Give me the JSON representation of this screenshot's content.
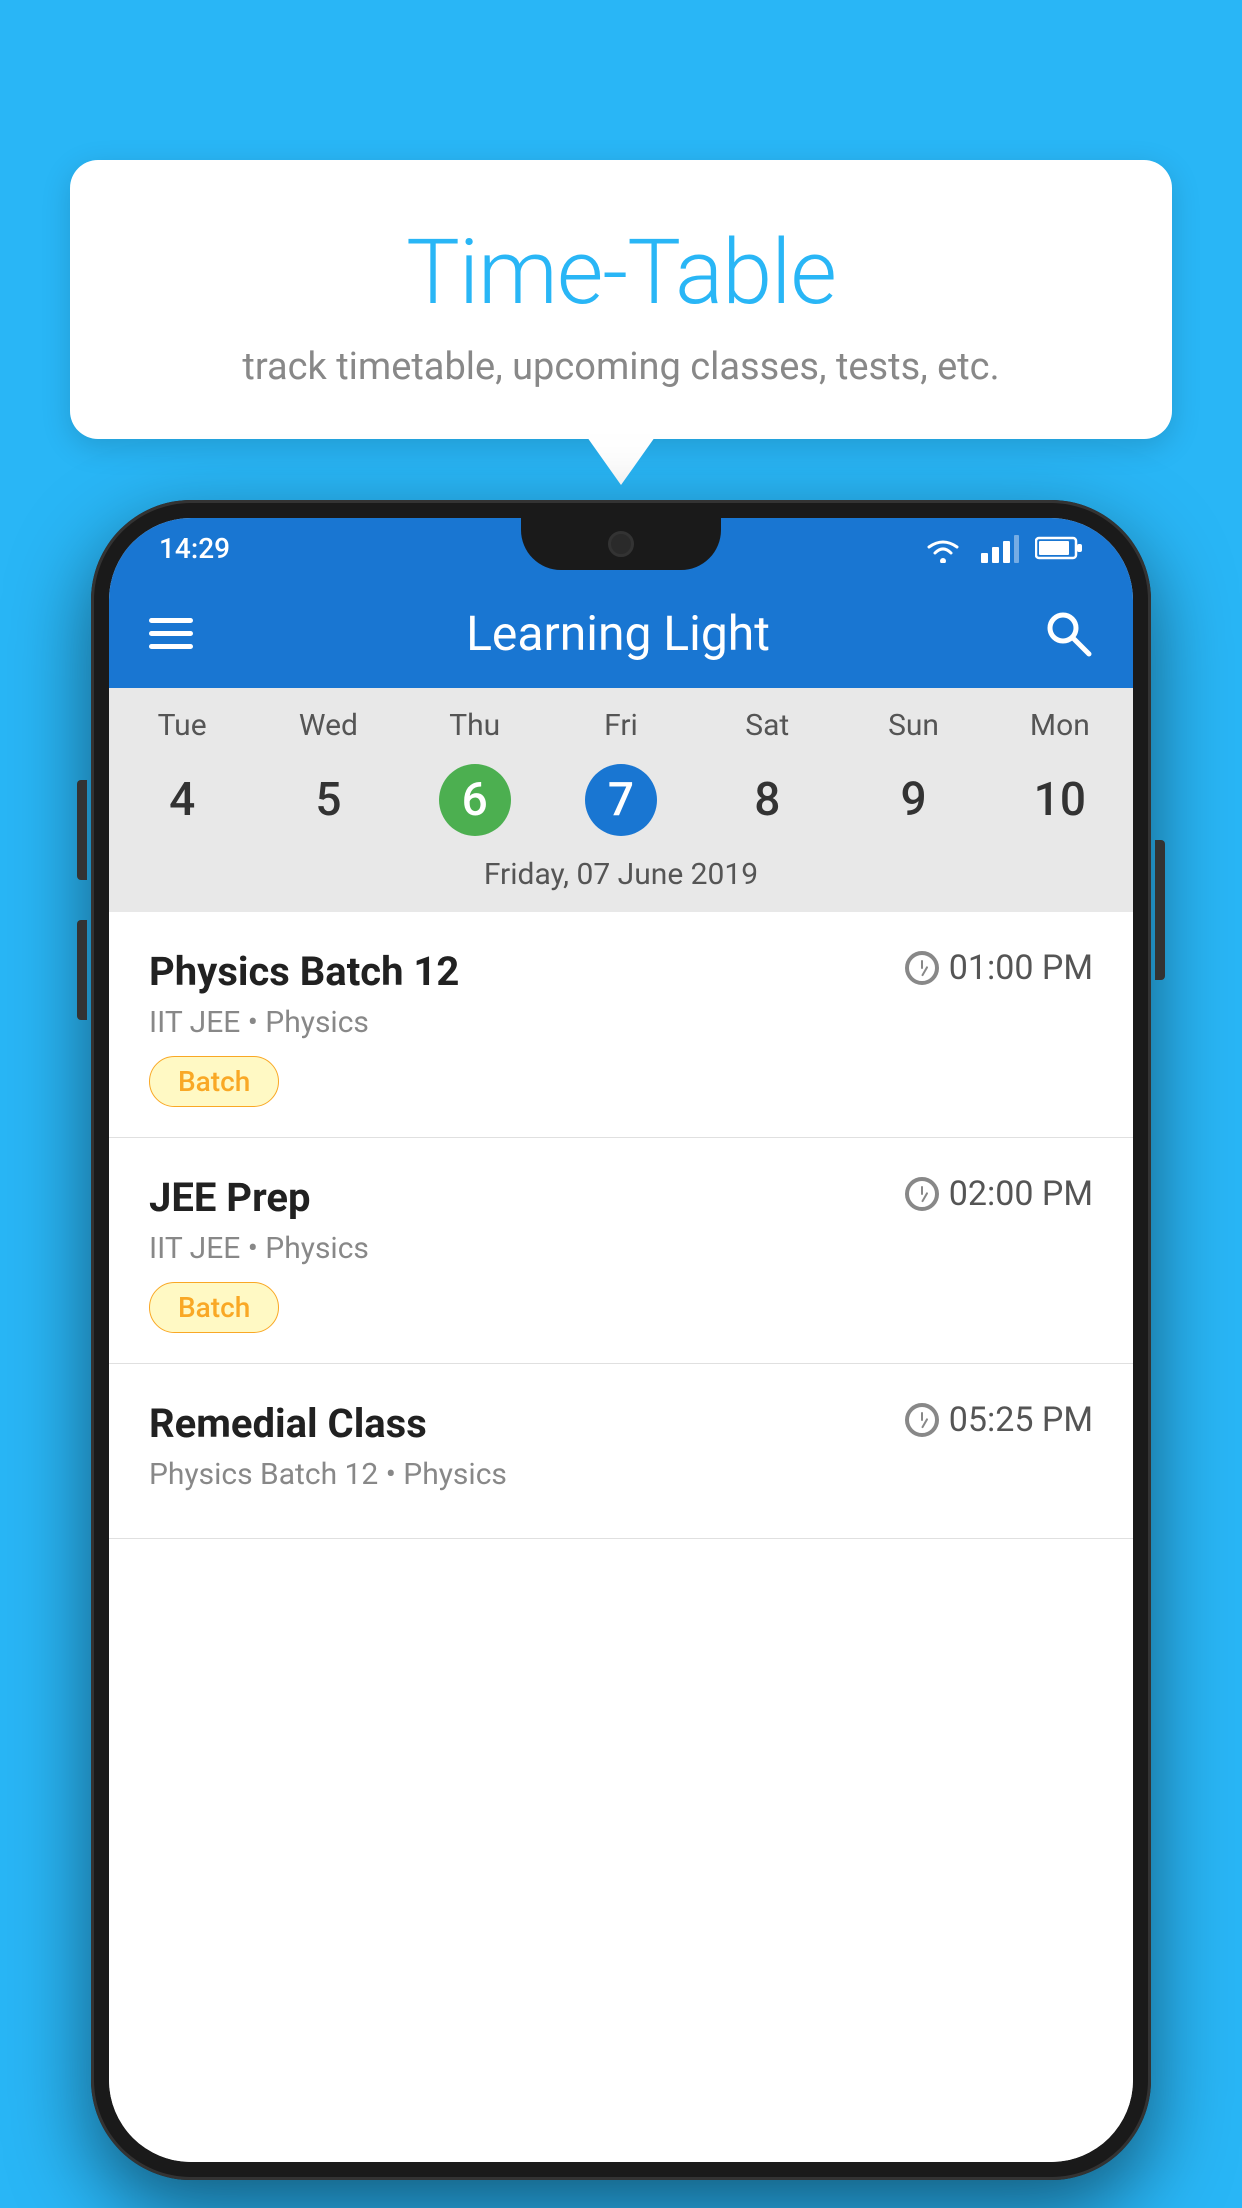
{
  "background_color": "#29B6F6",
  "tooltip": {
    "title": "Time-Table",
    "subtitle": "track timetable, upcoming classes, tests, etc."
  },
  "phone": {
    "status_bar": {
      "time": "14:29"
    },
    "app_bar": {
      "title": "Learning Light"
    },
    "calendar": {
      "day_headers": [
        "Tue",
        "Wed",
        "Thu",
        "Fri",
        "Sat",
        "Sun",
        "Mon"
      ],
      "day_numbers": [
        {
          "num": "4",
          "state": "normal"
        },
        {
          "num": "5",
          "state": "normal"
        },
        {
          "num": "6",
          "state": "today"
        },
        {
          "num": "7",
          "state": "selected"
        },
        {
          "num": "8",
          "state": "normal"
        },
        {
          "num": "9",
          "state": "normal"
        },
        {
          "num": "10",
          "state": "normal"
        }
      ],
      "selected_date_label": "Friday, 07 June 2019"
    },
    "schedule": [
      {
        "class_name": "Physics Batch 12",
        "time": "01:00 PM",
        "meta": "IIT JEE • Physics",
        "badge": "Batch"
      },
      {
        "class_name": "JEE Prep",
        "time": "02:00 PM",
        "meta": "IIT JEE • Physics",
        "badge": "Batch"
      },
      {
        "class_name": "Remedial Class",
        "time": "05:25 PM",
        "meta": "Physics Batch 12 • Physics",
        "badge": null
      }
    ]
  }
}
